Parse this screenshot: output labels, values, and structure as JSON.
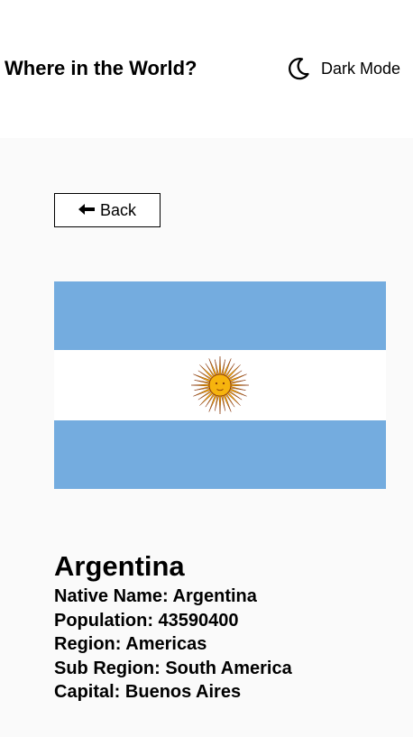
{
  "header": {
    "title": "Where in the World?",
    "mode_toggle": {
      "icon": "moon-icon",
      "label": "Dark Mode"
    }
  },
  "back_button": {
    "icon": "left-arrow-icon",
    "label": "Back"
  },
  "country": {
    "flag": {
      "icon": "flag-of-argentina",
      "colors": {
        "sky_blue": "#74acdf",
        "white": "#ffffff",
        "sun": "#f6b40e",
        "sun_outline": "#85340a"
      }
    },
    "name": "Argentina",
    "details": [
      {
        "label": "Native Name:",
        "value": "Argentina"
      },
      {
        "label": "Population:",
        "value": "43590400"
      },
      {
        "label": "Region:",
        "value": "Americas"
      },
      {
        "label": "Sub Region:",
        "value": "South America"
      },
      {
        "label": "Capital:",
        "value": "Buenos Aires"
      }
    ]
  }
}
